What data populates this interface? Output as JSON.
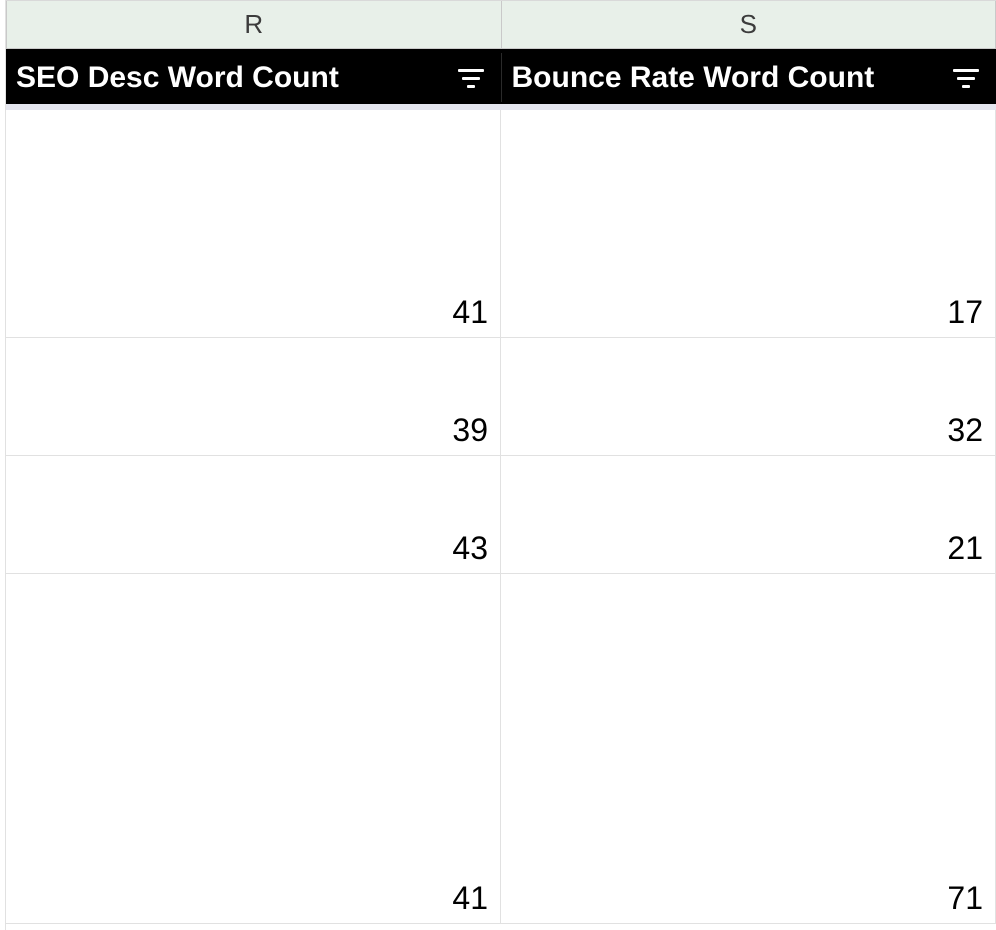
{
  "columns": [
    {
      "letter": "R",
      "header": "SEO Desc Word Count"
    },
    {
      "letter": "S",
      "header": "Bounce Rate Word Count"
    }
  ],
  "rows": [
    {
      "r": "41",
      "s": "17"
    },
    {
      "r": "39",
      "s": "32"
    },
    {
      "r": "43",
      "s": "21"
    },
    {
      "r": "41",
      "s": "71"
    }
  ]
}
